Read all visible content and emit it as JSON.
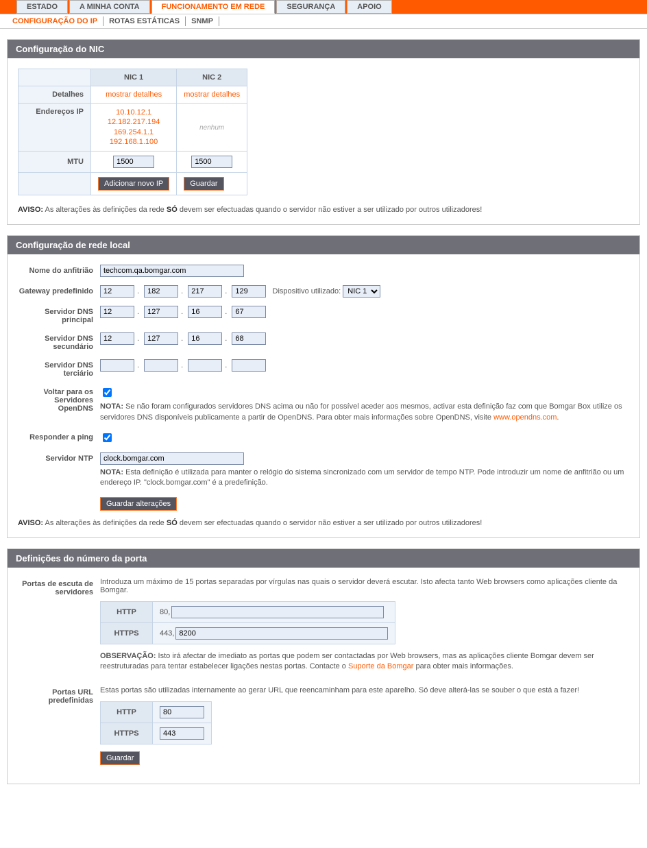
{
  "tabs": {
    "main": [
      "ESTADO",
      "A MINHA CONTA",
      "FUNCIONAMENTO EM REDE",
      "SEGURANÇA",
      "APOIO"
    ],
    "main_active": 2,
    "sub": [
      "CONFIGURAÇÃO DO IP",
      "ROTAS ESTÁTICAS",
      "SNMP"
    ],
    "sub_active": 0
  },
  "nic": {
    "title": "Configuração do NIC",
    "cols": [
      "NIC 1",
      "NIC 2"
    ],
    "rows": {
      "details_label": "Detalhes",
      "details_link": "mostrar detalhes",
      "ips_label": "Endereços IP",
      "ips_nic1": [
        "10.10.12.1",
        "12.182.217.194",
        "169.254.1.1",
        "192.168.1.100"
      ],
      "ips_nic2_none": "nenhum",
      "mtu_label": "MTU",
      "mtu_nic1": "1500",
      "mtu_nic2": "1500"
    },
    "btn_add_ip": "Adicionar novo IP",
    "btn_save": "Guardar",
    "warning_prefix": "AVISO:",
    "warning_text_a": " As alterações às definições da rede ",
    "warning_so": "SÓ",
    "warning_text_b": " devem ser efectuadas quando o servidor não estiver a ser utilizado por outros utilizadores!"
  },
  "lan": {
    "title": "Configuração de rede local",
    "hostname_label": "Nome do anfitrião",
    "hostname": "techcom.qa.bomgar.com",
    "gateway_label": "Gateway predefinido",
    "gateway": [
      "12",
      "182",
      "217",
      "129"
    ],
    "device_label": "Dispositivo utilizado:",
    "device_options": [
      "NIC 1"
    ],
    "dns1_label": "Servidor DNS principal",
    "dns1": [
      "12",
      "127",
      "16",
      "67"
    ],
    "dns2_label": "Servidor DNS secundário",
    "dns2": [
      "12",
      "127",
      "16",
      "68"
    ],
    "dns3_label": "Servidor DNS terciário",
    "dns3": [
      "",
      "",
      "",
      ""
    ],
    "opendns_label": "Voltar para os Servidores OpenDNS",
    "opendns_checked": true,
    "opendns_note_prefix": "NOTA:",
    "opendns_note": " Se não foram configurados servidores DNS acima ou não for possível aceder aos mesmos, activar esta definição faz com que Bomgar Box utilize os servidores DNS disponíveis publicamente a partir de OpenDNS. Para obter mais informações sobre OpenDNS, visite ",
    "opendns_link": "www.opendns.com",
    "ping_label": "Responder a ping",
    "ping_checked": true,
    "ntp_label": "Servidor NTP",
    "ntp": "clock.bomgar.com",
    "ntp_note_prefix": "NOTA:",
    "ntp_note": " Esta definição é utilizada para manter o relógio do sistema sincronizado com um servidor de tempo NTP. Pode introduzir um nome de anfitrião ou um endereço IP. \"clock.bomgar.com\" é a predefinição.",
    "btn_save": "Guardar alterações"
  },
  "ports": {
    "title": "Definições do número da porta",
    "listen_label": "Portas de escuta de servidores",
    "listen_desc": "Introduza um máximo de 15 portas separadas por vírgulas nas quais o servidor deverá escutar. Isto afecta tanto Web browsers como aplicações cliente da Bomgar.",
    "http_label": "HTTP",
    "https_label": "HTTPS",
    "listen_http_prefix": "80,",
    "listen_http_val": "",
    "listen_https_prefix": "443,",
    "listen_https_val": "8200",
    "listen_obs_prefix": "OBSERVAÇÃO:",
    "listen_obs_a": " Isto irá afectar de imediato as portas que podem ser contactadas por Web browsers, mas as aplicações cliente Bomgar devem ser reestruturadas para tentar estabelecer ligações nestas portas. Contacte o ",
    "listen_obs_link": "Suporte da Bomgar",
    "listen_obs_b": " para obter mais informações.",
    "url_label": "Portas URL predefinidas",
    "url_desc": "Estas portas são utilizadas internamente ao gerar URL que reencaminham para este aparelho. Só deve alterá-las se souber o que está a fazer!",
    "url_http": "80",
    "url_https": "443",
    "btn_save": "Guardar"
  }
}
